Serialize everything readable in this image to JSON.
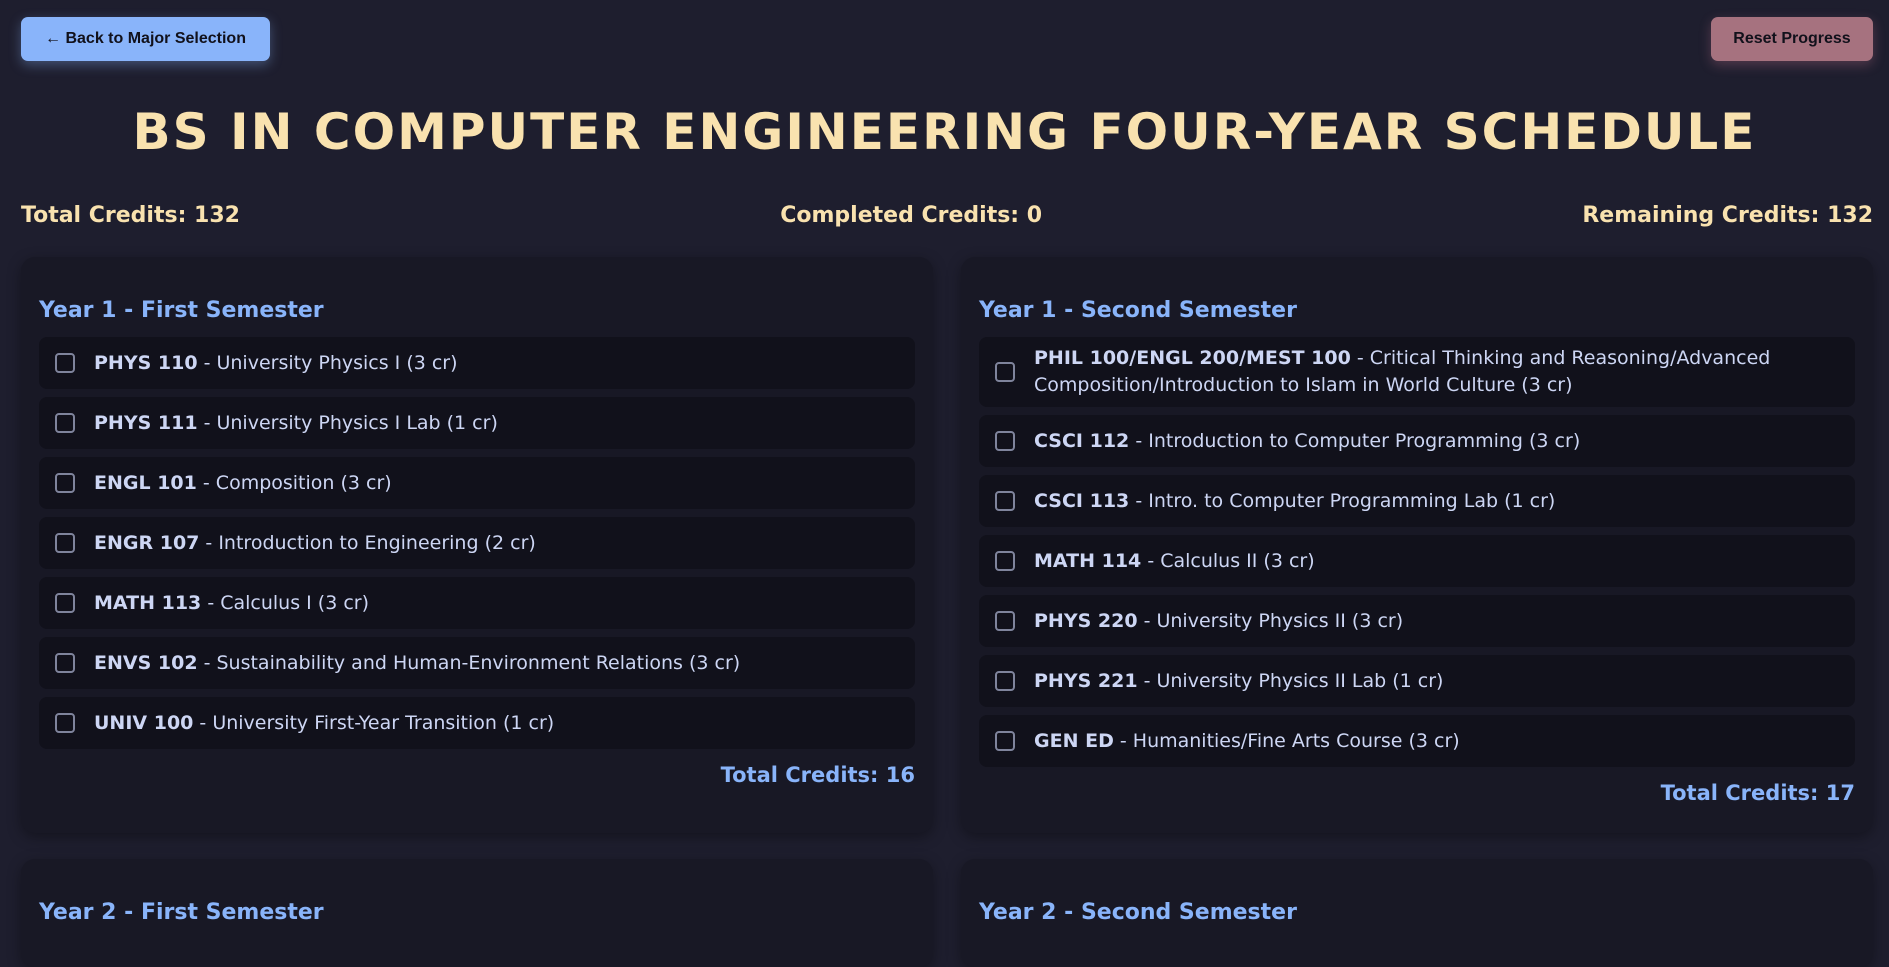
{
  "header": {
    "back_label": "← Back to Major Selection",
    "reset_label": "Reset Progress",
    "title": "BS IN COMPUTER ENGINEERING FOUR-YEAR SCHEDULE"
  },
  "stats": {
    "total": "Total Credits: 132",
    "completed": "Completed Credits: 0",
    "remaining": "Remaining Credits: 132"
  },
  "semesters": [
    {
      "title": "Year 1 - First Semester",
      "total": "Total Credits: 16",
      "courses": [
        {
          "code": "PHYS 110",
          "desc": "University Physics I (3 cr)"
        },
        {
          "code": "PHYS 111",
          "desc": "University Physics I Lab (1 cr)"
        },
        {
          "code": "ENGL 101",
          "desc": "Composition (3 cr)"
        },
        {
          "code": "ENGR 107",
          "desc": "Introduction to Engineering (2 cr)"
        },
        {
          "code": "MATH 113",
          "desc": "Calculus I (3 cr)"
        },
        {
          "code": "ENVS 102",
          "desc": "Sustainability and Human-Environment Relations (3 cr)"
        },
        {
          "code": "UNIV 100",
          "desc": "University First-Year Transition (1 cr)"
        }
      ]
    },
    {
      "title": "Year 1 - Second Semester",
      "total": "Total Credits: 17",
      "courses": [
        {
          "code": "PHIL 100/ENGL 200/MEST 100",
          "desc": "Critical Thinking and Reasoning/Advanced Composition/Introduction to Islam in World Culture (3 cr)"
        },
        {
          "code": "CSCI 112",
          "desc": "Introduction to Computer Programming (3 cr)"
        },
        {
          "code": "CSCI 113",
          "desc": "Intro. to Computer Programming Lab (1 cr)"
        },
        {
          "code": "MATH 114",
          "desc": "Calculus II (3 cr)"
        },
        {
          "code": "PHYS 220",
          "desc": "University Physics II (3 cr)"
        },
        {
          "code": "PHYS 221",
          "desc": "University Physics II Lab (1 cr)"
        },
        {
          "code": "GEN ED",
          "desc": "Humanities/Fine Arts Course (3 cr)"
        }
      ]
    },
    {
      "title": "Year 2 - First Semester",
      "total": "",
      "courses": []
    },
    {
      "title": "Year 2 - Second Semester",
      "total": "",
      "courses": []
    }
  ],
  "separator": " - "
}
